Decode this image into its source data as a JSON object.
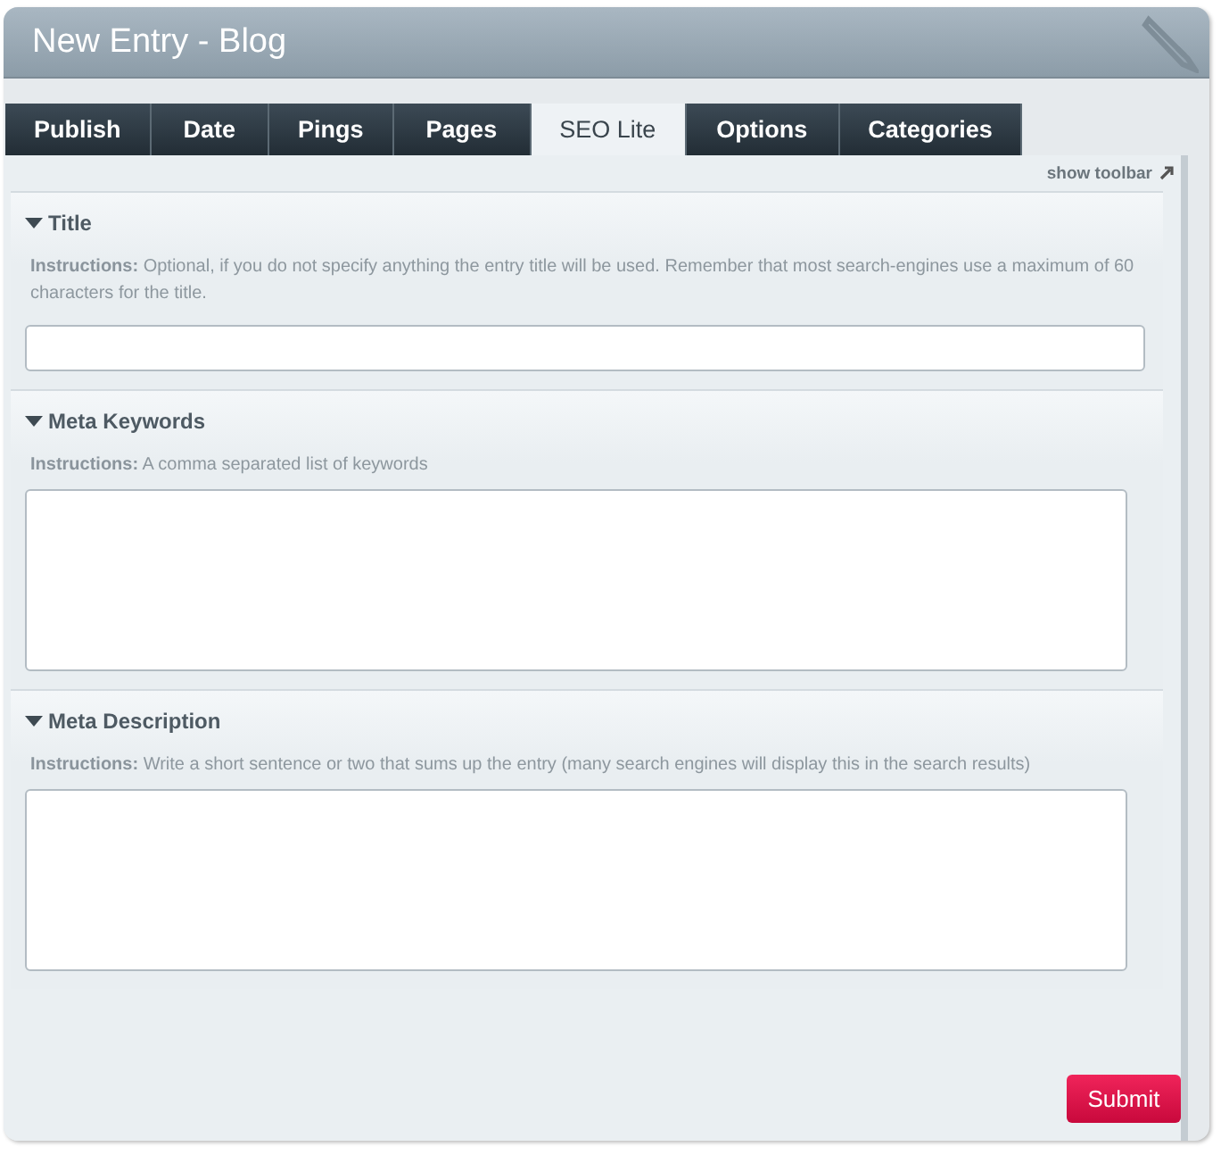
{
  "window": {
    "title": "New Entry - Blog"
  },
  "tabs": [
    {
      "label": "Publish",
      "selected": false
    },
    {
      "label": "Date",
      "selected": false
    },
    {
      "label": "Pings",
      "selected": false
    },
    {
      "label": "Pages",
      "selected": false
    },
    {
      "label": "SEO Lite",
      "selected": true
    },
    {
      "label": "Options",
      "selected": false
    },
    {
      "label": "Categories",
      "selected": false
    }
  ],
  "toolbar_toggle": "show toolbar",
  "sections": [
    {
      "title": "Title",
      "expanded": true,
      "instructions": "**Instructions:**  Optional, if you do not specify anything the entry title will be used. Remember that most search-engines use a maximum of 60 characters for the title.",
      "kind": "input"
    },
    {
      "title": "Meta Keywords",
      "expanded": true,
      "instructions": "**Instructions:**  A comma separated list of keywords",
      "kind": "textarea"
    },
    {
      "title": "Meta Description",
      "expanded": true,
      "instructions": "**Instructions:**  Write a short sentence or two that sums up the entry (many search engines will display this in the search results)",
      "kind": "textarea"
    }
  ],
  "submit": "Submit"
}
